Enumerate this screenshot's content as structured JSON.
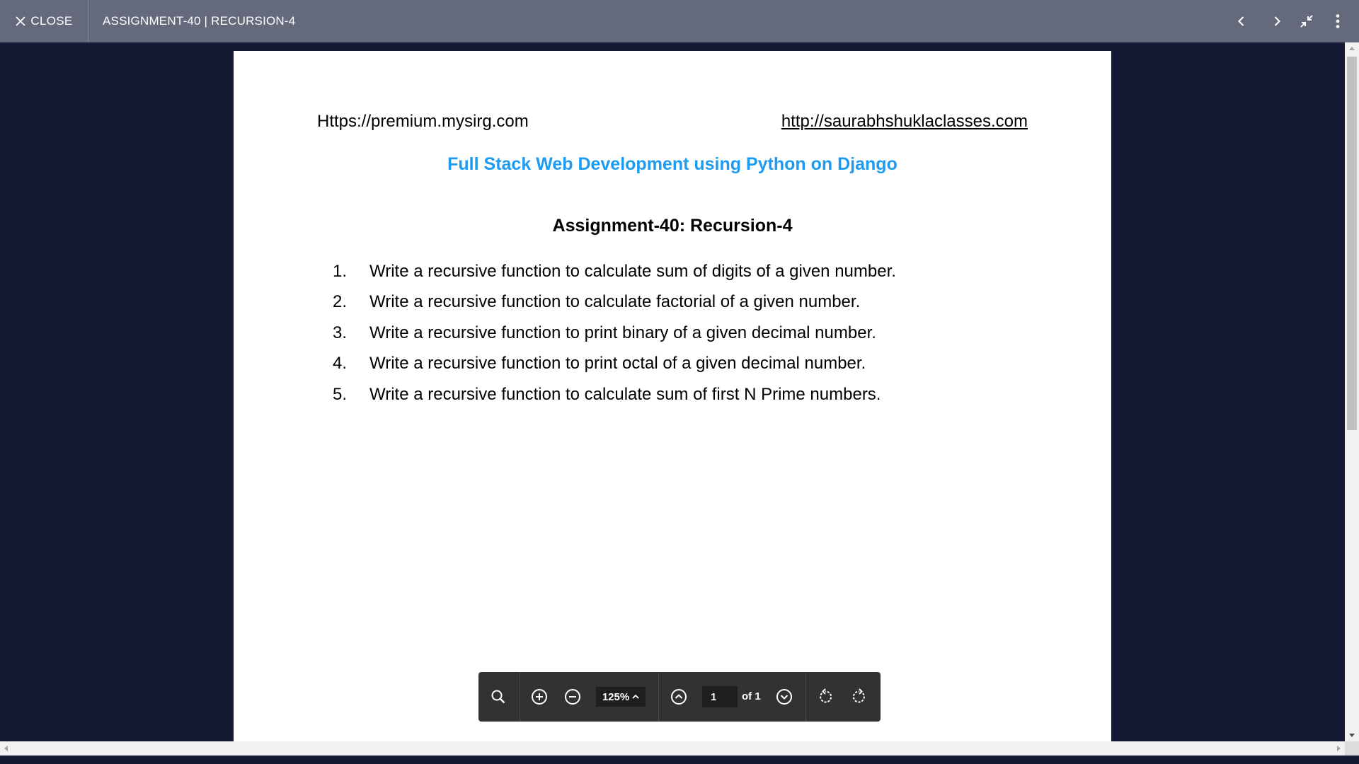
{
  "topbar": {
    "close_label": "CLOSE",
    "title": "ASSIGNMENT-40 | RECURSION-4",
    "icons": [
      "chevron-left-icon",
      "chevron-right-icon",
      "exit-fullscreen-icon",
      "more-vert-icon"
    ]
  },
  "document": {
    "url_left": "Https://premium.mysirg.com",
    "url_right": "http://saurabhshuklaclasses.com",
    "course_title": "Full Stack Web Development using Python on Django",
    "assignment_title": "Assignment-40: Recursion-4",
    "questions": [
      {
        "num": "1.",
        "text": "Write a recursive function to calculate sum of digits of a given number."
      },
      {
        "num": "2.",
        "text": "Write a recursive function to calculate factorial of a given number."
      },
      {
        "num": "3.",
        "text": "Write a recursive function to print binary of a given decimal number."
      },
      {
        "num": "4.",
        "text": "Write a recursive function to print octal of a given decimal number."
      },
      {
        "num": "5.",
        "text": "Write a recursive function to calculate sum of first N Prime numbers."
      }
    ],
    "colors": {
      "course_title": "#1e9bf0",
      "topbar": "#646a7c",
      "background": "#141a33"
    }
  },
  "toolbar": {
    "zoom": "125%",
    "page_current": "1",
    "page_total_label": "of 1",
    "icons": [
      "search-icon",
      "zoom-in-icon",
      "zoom-out-icon",
      "page-up-icon",
      "page-down-icon",
      "rotate-left-icon",
      "rotate-right-icon"
    ]
  }
}
